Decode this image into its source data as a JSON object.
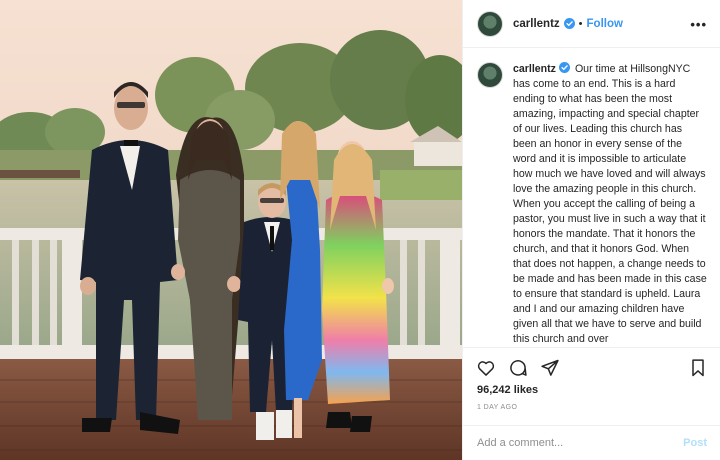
{
  "post": {
    "username": "carllentz",
    "verified": true,
    "follow_label": "Follow",
    "separator": "•",
    "more_icon": "•••",
    "caption": "Our time at HillsongNYC has come to an end. This is a hard ending to what has been the most amazing, impacting and special chapter of our lives. Leading this church has been an honor in every sense of the word and it is impossible to articulate how much we have loved and will always love the amazing people in this church. When you accept the calling of being a pastor, you must live in such a way that it honors the mandate. That it honors the church, and that it honors God. When that does not happen, a change needs to be made and has been made in this case to ensure that standard is upheld. Laura and I and our amazing children have given all that we have to serve and build this church and over",
    "likes": "96,242 likes",
    "timestamp": "1 DAY AGO",
    "comment_placeholder": "Add a comment...",
    "post_label": "Post"
  },
  "icons": {
    "verified": "verified-badge-icon",
    "like": "heart-icon",
    "comment": "comment-bubble-icon",
    "share": "paper-plane-icon",
    "save": "bookmark-icon",
    "more": "more-options-icon"
  },
  "colors": {
    "link_blue": "#3897f0",
    "post_disabled": "#b2dffc",
    "border": "#efefef",
    "muted": "#8e8e8e"
  }
}
